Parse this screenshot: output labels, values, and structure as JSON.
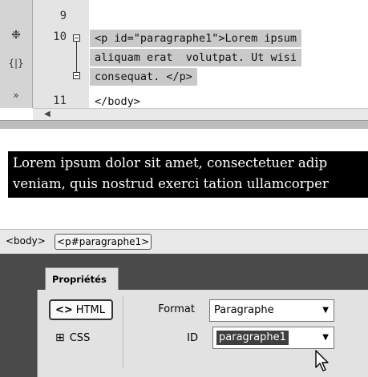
{
  "code_editor": {
    "line_numbers": [
      "9",
      "10",
      "11"
    ],
    "lines": [
      "<p id=\"paragraphe1\">Lorem ipsum",
      "aliquam erat  volutpat. Ut wisi",
      "consequat. </p>",
      "</body>"
    ],
    "toolbar_icons": [
      "collapse-icon",
      "braces-icon",
      "more-icon"
    ]
  },
  "design_view": {
    "selected_lines": [
      "Lorem ipsum dolor sit amet, consectetuer adip",
      "veniam, quis nostrud exerci tation ullamcorper"
    ]
  },
  "tag_selector": {
    "tags": [
      "<body>",
      "<p#paragraphe1>"
    ]
  },
  "properties": {
    "tab_label": "Propriétés",
    "html_button": "HTML",
    "css_button": "CSS",
    "format_label": "Format",
    "format_value": "Paragraphe",
    "id_label": "ID",
    "id_value": "paragraphe1"
  }
}
